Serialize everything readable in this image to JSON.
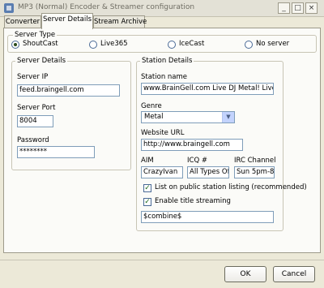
{
  "window": {
    "title": "MP3 (Normal) Encoder & Streamer configuration",
    "controls": {
      "minimize": "_",
      "maximize": "□",
      "close": "×"
    }
  },
  "tabs": [
    {
      "label": "Converter",
      "active": false
    },
    {
      "label": "Server Details",
      "active": true
    },
    {
      "label": "Stream Archive",
      "active": false
    }
  ],
  "server_type": {
    "legend": "Server Type",
    "options": [
      {
        "label": "ShoutCast",
        "selected": true
      },
      {
        "label": "Live365",
        "selected": false
      },
      {
        "label": "IceCast",
        "selected": false
      },
      {
        "label": "No server",
        "selected": false
      }
    ]
  },
  "server_details": {
    "legend": "Server Details",
    "ip_label": "Server IP",
    "ip_value": "feed.braingell.com",
    "port_label": "Server Port",
    "port_value": "8004",
    "password_label": "Password",
    "password_value": "********"
  },
  "station_details": {
    "legend": "Station Details",
    "name_label": "Station name",
    "name_value": "www.BrainGell.com Live DJ Metal! Live Re",
    "genre_label": "Genre",
    "genre_value": "Metal",
    "url_label": "Website URL",
    "url_value": "http://www.braingell.com",
    "aim_label": "AIM",
    "aim_value": "CrazyIvan",
    "icq_label": "ICQ #",
    "icq_value": "All Types Of",
    "irc_label": "IRC Channel",
    "irc_value": "Sun 5pm-8p",
    "public_label": "List on public station listing (recommended)",
    "public_checked": true,
    "title_label": "Enable title streaming",
    "title_checked": true,
    "title_value": "$combine$"
  },
  "footer": {
    "ok_label": "OK",
    "cancel_label": "Cancel"
  }
}
